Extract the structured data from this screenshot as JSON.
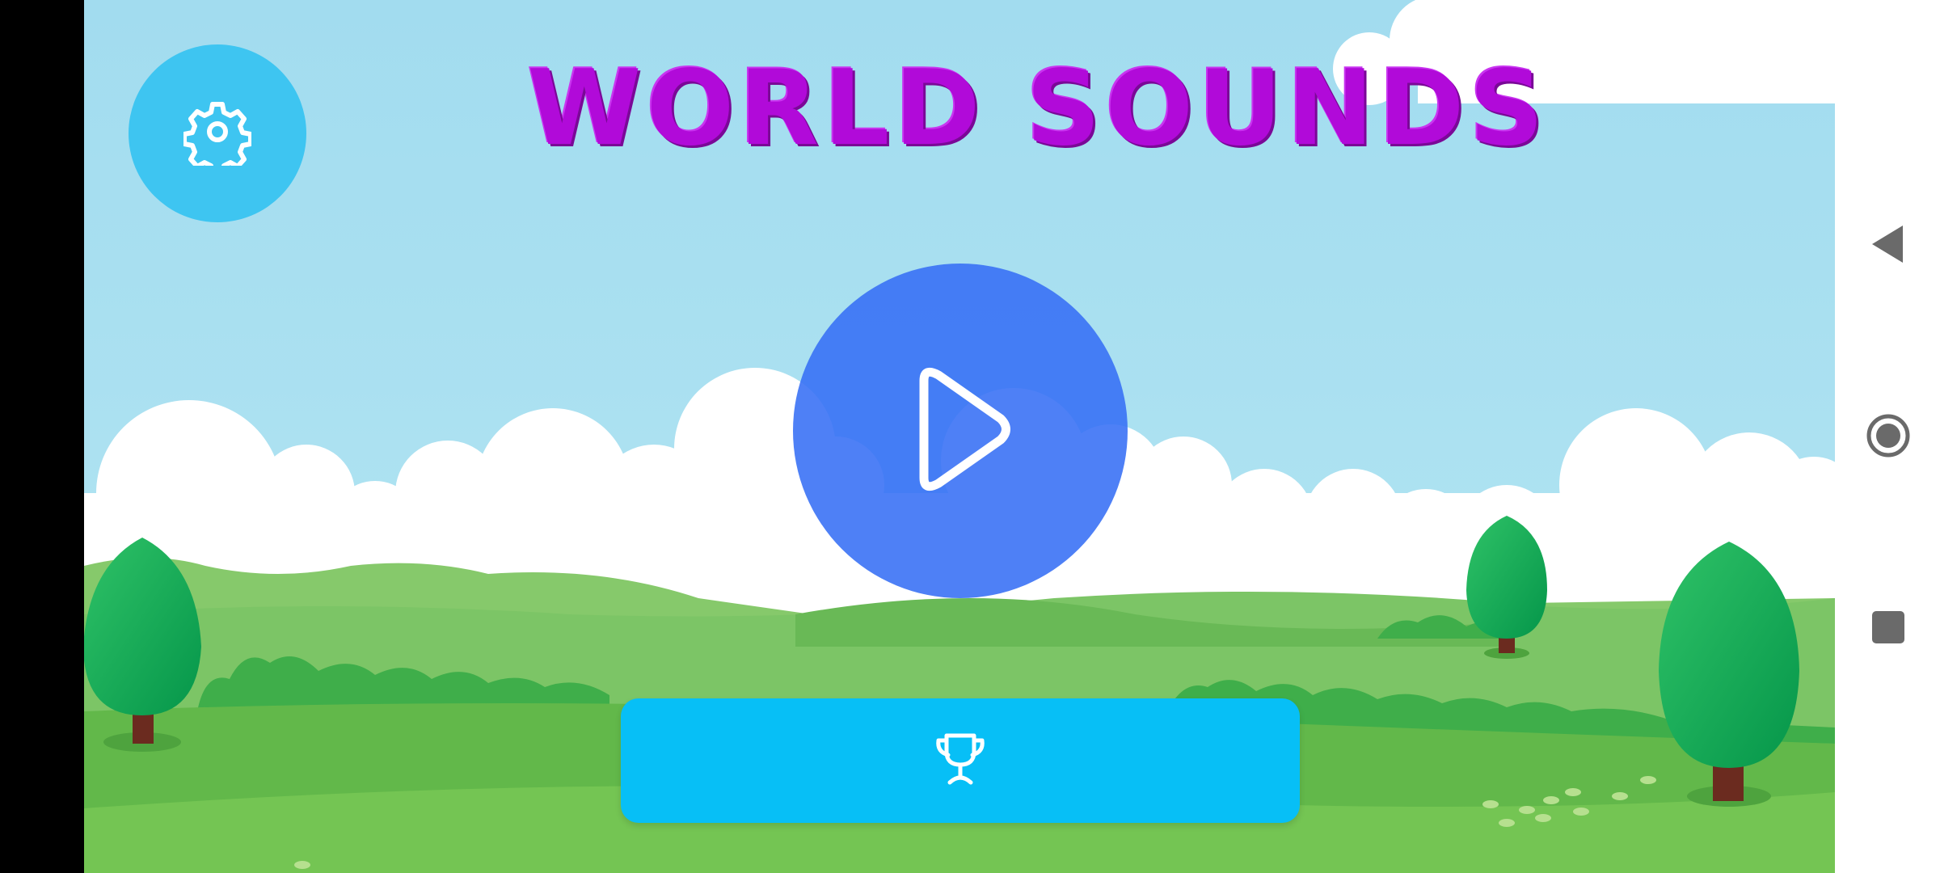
{
  "app": {
    "title": "WORLD SOUNDS"
  },
  "buttons": {
    "settings": {
      "icon": "gear-icon"
    },
    "play": {
      "icon": "play-icon"
    },
    "leaderboard": {
      "icon": "trophy-icon"
    }
  },
  "system_nav": {
    "back": {
      "icon": "back-triangle-icon"
    },
    "home": {
      "icon": "home-circle-icon"
    },
    "recents": {
      "icon": "recents-square-icon"
    }
  },
  "colors": {
    "title": "#b10ad9",
    "settings_button": "#3ec5f1",
    "play_button": "#366ef5",
    "leaderboard_button": "#07bff6",
    "sky": "#a6dff0",
    "grass": "#6cbf4f"
  }
}
